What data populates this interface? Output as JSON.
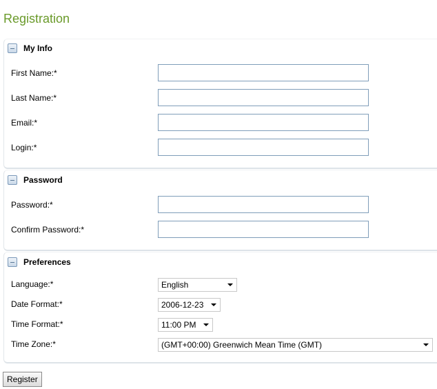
{
  "page": {
    "title": "Registration"
  },
  "sections": {
    "my_info": {
      "title": "My Info",
      "fields": {
        "first_name": {
          "label": "First Name:*",
          "value": ""
        },
        "last_name": {
          "label": "Last Name:*",
          "value": ""
        },
        "email": {
          "label": "Email:*",
          "value": ""
        },
        "login": {
          "label": "Login:*",
          "value": ""
        }
      }
    },
    "password": {
      "title": "Password",
      "fields": {
        "password": {
          "label": "Password:*",
          "value": ""
        },
        "confirm_password": {
          "label": "Confirm Password:*",
          "value": ""
        }
      }
    },
    "preferences": {
      "title": "Preferences",
      "fields": {
        "language": {
          "label": "Language:*",
          "selected": "English"
        },
        "date_format": {
          "label": "Date Format:*",
          "selected": "2006-12-23"
        },
        "time_format": {
          "label": "Time Format:*",
          "selected": "11:00 PM"
        },
        "time_zone": {
          "label": "Time Zone:*",
          "selected": "(GMT+00:00) Greenwich Mean Time (GMT)"
        }
      }
    }
  },
  "actions": {
    "register_label": "Register"
  },
  "icons": {
    "section_toggle": "collapse-minus-icon",
    "select_arrow": "dropdown-arrow-icon"
  },
  "colors": {
    "title": "#6a9a2a",
    "input_border": "#7f9db9"
  }
}
